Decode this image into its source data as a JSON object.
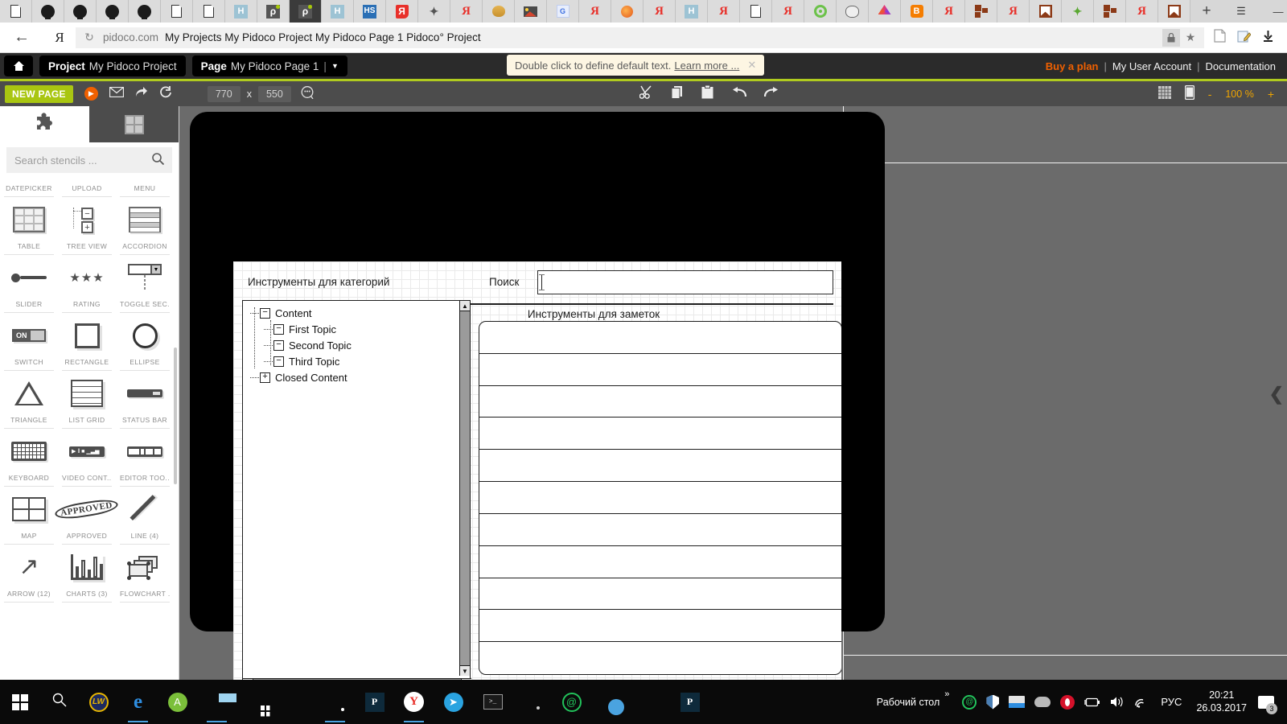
{
  "browser": {
    "tabs": [
      {
        "icon": "document-icon",
        "type": "doc",
        "active": false
      },
      {
        "icon": "github-icon",
        "type": "gh",
        "active": false
      },
      {
        "icon": "github-icon",
        "type": "gh",
        "active": false
      },
      {
        "icon": "github-icon",
        "type": "gh",
        "active": false
      },
      {
        "icon": "github-icon",
        "type": "gh",
        "active": false
      },
      {
        "icon": "document-icon",
        "type": "doc",
        "active": false
      },
      {
        "icon": "document-icon",
        "type": "doc",
        "active": false
      },
      {
        "icon": "habr-icon",
        "type": "h",
        "active": false
      },
      {
        "icon": "pidoco-icon",
        "type": "p",
        "active": false
      },
      {
        "icon": "pidoco-icon",
        "type": "p",
        "active": true
      },
      {
        "icon": "habr-icon",
        "type": "h",
        "active": false
      },
      {
        "icon": "hs-icon",
        "type": "hs",
        "active": false
      },
      {
        "icon": "yandex-red-icon",
        "type": "yar",
        "active": false
      },
      {
        "icon": "puzzle-icon",
        "type": "puz",
        "active": false
      },
      {
        "icon": "yandex-icon",
        "type": "ya",
        "active": false
      },
      {
        "icon": "honey-icon",
        "type": "honey",
        "active": false
      },
      {
        "icon": "image-icon",
        "type": "img",
        "active": false
      },
      {
        "icon": "google-translate-icon",
        "type": "gt",
        "active": false
      },
      {
        "icon": "yandex-icon",
        "type": "ya",
        "active": false
      },
      {
        "icon": "firefox-icon",
        "type": "fox",
        "active": false
      },
      {
        "icon": "yandex-icon",
        "type": "ya",
        "active": false
      },
      {
        "icon": "habr-icon",
        "type": "h",
        "active": false
      },
      {
        "icon": "yandex-icon",
        "type": "ya",
        "active": false
      },
      {
        "icon": "document-icon",
        "type": "doc",
        "active": false
      },
      {
        "icon": "yandex-icon",
        "type": "ya",
        "active": false
      },
      {
        "icon": "target-icon",
        "type": "target",
        "active": false
      },
      {
        "icon": "gnu-icon",
        "type": "gnu",
        "active": false
      },
      {
        "icon": "prism-icon",
        "type": "prism",
        "active": false
      },
      {
        "icon": "blogger-icon",
        "type": "blogger",
        "active": false
      },
      {
        "icon": "yandex-icon",
        "type": "ya",
        "active": false
      },
      {
        "icon": "tetris-icon",
        "type": "tetris",
        "active": false
      },
      {
        "icon": "yandex-icon",
        "type": "ya",
        "active": false
      },
      {
        "icon": "flag-icon",
        "type": "flag",
        "active": false
      },
      {
        "icon": "puzzle-green-icon",
        "type": "puzg",
        "active": false
      },
      {
        "icon": "tetris-icon",
        "type": "tetris",
        "active": false
      },
      {
        "icon": "yandex-icon",
        "type": "ya",
        "active": false
      },
      {
        "icon": "flag-icon",
        "type": "flag",
        "active": false
      }
    ],
    "new_tab_label": "+",
    "window_controls": {
      "minimize": "—",
      "maximize": "☐",
      "close": "✕",
      "menu": "☰"
    },
    "back_label": "←",
    "brand_letter": "Я",
    "reload_label": "↻",
    "url_domain": "pidoco.com",
    "url_title": "My Projects My Pidoco Project My Pidoco Page 1 Pidoco° Project",
    "lock_label": "🔒",
    "star_label": "★",
    "right_icons": [
      "reader-icon",
      "notes-icon",
      "download-icon"
    ]
  },
  "app": {
    "home_icon": "home-icon",
    "breadcrumbs": [
      {
        "prefix": "Project",
        "value": "My Pidoco Project",
        "has_caret": false
      },
      {
        "prefix": "Page",
        "value": "My Pidoco Page 1",
        "has_caret": true
      }
    ],
    "caret_glyph": "▼",
    "tooltip": {
      "text": "Double click to define default text.",
      "link": "Learn more ...",
      "close": "✕"
    },
    "top_links": {
      "buy_plan": "Buy a plan",
      "user_account": "My User Account",
      "documentation": "Documentation",
      "separator": "|"
    },
    "toolbar": {
      "new_page_label": "NEW PAGE",
      "play_label": "▶",
      "mail_icon": "envelope-icon",
      "share_icon": "share-icon",
      "refresh_icon": "refresh-icon",
      "width_value": "770",
      "x_label": "x",
      "height_value": "550",
      "dimension_icon": "comment-icon",
      "cut_icon": "scissors-icon",
      "copy_icon": "copy-icon",
      "paste_icon": "clipboard-icon",
      "undo_icon": "undo-icon",
      "redo_icon": "redo-icon",
      "grid_icon": "grid-icon",
      "device_icon": "mobile-icon",
      "zoom_out": "-",
      "zoom_value": "100 %",
      "zoom_in": "+"
    }
  },
  "sidebar": {
    "tabs": [
      {
        "name": "stencils-tab",
        "icon": "puzzle-piece-icon",
        "active": true
      },
      {
        "name": "templates-tab",
        "icon": "grid-puzzle-icon",
        "active": false
      }
    ],
    "search": {
      "placeholder": "Search stencils ...",
      "icon": "search-icon"
    },
    "cut_row": [
      "DATEPICKER",
      "UPLOAD",
      "MENU"
    ],
    "stencils": [
      {
        "label": "TABLE",
        "art": "table"
      },
      {
        "label": "TREE VIEW",
        "art": "tree"
      },
      {
        "label": "ACCORDION",
        "art": "accordion"
      },
      {
        "label": "SLIDER",
        "art": "slider"
      },
      {
        "label": "RATING",
        "art": "rating"
      },
      {
        "label": "TOGGLE SEC...",
        "art": "toggle"
      },
      {
        "label": "SWITCH",
        "art": "switch"
      },
      {
        "label": "RECTANGLE",
        "art": "rectangle"
      },
      {
        "label": "ELLIPSE",
        "art": "ellipse"
      },
      {
        "label": "TRIANGLE",
        "art": "triangle"
      },
      {
        "label": "LIST GRID",
        "art": "listgrid"
      },
      {
        "label": "STATUS BAR",
        "art": "statusbar"
      },
      {
        "label": "KEYBOARD",
        "art": "keyboard"
      },
      {
        "label": "VIDEO CONT...",
        "art": "video"
      },
      {
        "label": "EDITOR TOO...",
        "art": "editor"
      },
      {
        "label": "MAP",
        "art": "map"
      },
      {
        "label": "APPROVED",
        "art": "approved"
      },
      {
        "label": "LINE (4)",
        "art": "line"
      },
      {
        "label": "ARROW (12)",
        "art": "arrow"
      },
      {
        "label": "CHARTS (3)",
        "art": "charts"
      },
      {
        "label": "FLOWCHART ...",
        "art": "flowchart"
      }
    ],
    "rating_stars": "★★★",
    "arrow_glyph": "↗",
    "approved_text": "APPROVED"
  },
  "wireframe": {
    "category_tools_title": "Инструменты для категорий",
    "search_label": "Поиск",
    "search_value": "",
    "notes_tools_title": "Инструменты для заметок",
    "tree": [
      {
        "label": "Content",
        "state": "expanded",
        "glyph": "−",
        "level": 0
      },
      {
        "label": "First Topic",
        "state": "expanded",
        "glyph": "−",
        "level": 1
      },
      {
        "label": "Second Topic",
        "state": "expanded",
        "glyph": "−",
        "level": 1
      },
      {
        "label": "Third Topic",
        "state": "expanded",
        "glyph": "−",
        "level": 1
      },
      {
        "label": "Closed Content",
        "state": "collapsed",
        "glyph": "+",
        "level": 0
      }
    ],
    "scrollbar": {
      "up": "▲",
      "down": "▼",
      "left": "◀",
      "right": "▶"
    },
    "listgrid_rows": 11
  },
  "canvas": {
    "collapse_handle": "❮"
  },
  "taskbar": {
    "start_icon": "windows-start-icon",
    "search_icon": "search-icon",
    "items": [
      {
        "name": "lastpass-icon",
        "art": "lw",
        "running": false
      },
      {
        "name": "edge-icon",
        "art": "edge",
        "running": true
      },
      {
        "name": "android-studio-icon",
        "art": "as",
        "running": false
      },
      {
        "name": "file-explorer-icon",
        "art": "folder",
        "running": true
      },
      {
        "name": "microsoft-store-icon",
        "art": "store",
        "running": false
      },
      {
        "name": "paint-icon",
        "art": "gray",
        "running": false
      },
      {
        "name": "chrome-icon",
        "art": "chrome",
        "running": true
      },
      {
        "name": "pw-icon",
        "art": "pw",
        "running": false
      },
      {
        "name": "yandex-browser-icon",
        "art": "yb",
        "running": true
      },
      {
        "name": "telegram-icon",
        "art": "tg",
        "running": false
      },
      {
        "name": "command-prompt-icon",
        "art": "cmd",
        "running": false
      },
      {
        "name": "camera-icon",
        "art": "cam",
        "running": false
      },
      {
        "name": "at-icon",
        "art": "at",
        "running": false
      },
      {
        "name": "moon-icon",
        "art": "moon",
        "running": false
      },
      {
        "name": "mountain-icon",
        "art": "mtn",
        "running": false
      },
      {
        "name": "pw2-icon",
        "art": "pw2",
        "running": false
      },
      {
        "name": "pin-icon",
        "art": "pin",
        "running": false
      },
      {
        "name": "bars-icon",
        "art": "bars",
        "running": false
      }
    ],
    "desktop_label": "Рабочий стол",
    "tray_expand": "»",
    "tray_icons": [
      "at-icon",
      "shield-icon",
      "keyboard-icon",
      "onedrive-icon",
      "opera-icon",
      "battery-icon",
      "volume-icon",
      "wifi-icon"
    ],
    "language": "РУС",
    "time": "20:21",
    "date": "26.03.2017",
    "notification_count": "3"
  }
}
